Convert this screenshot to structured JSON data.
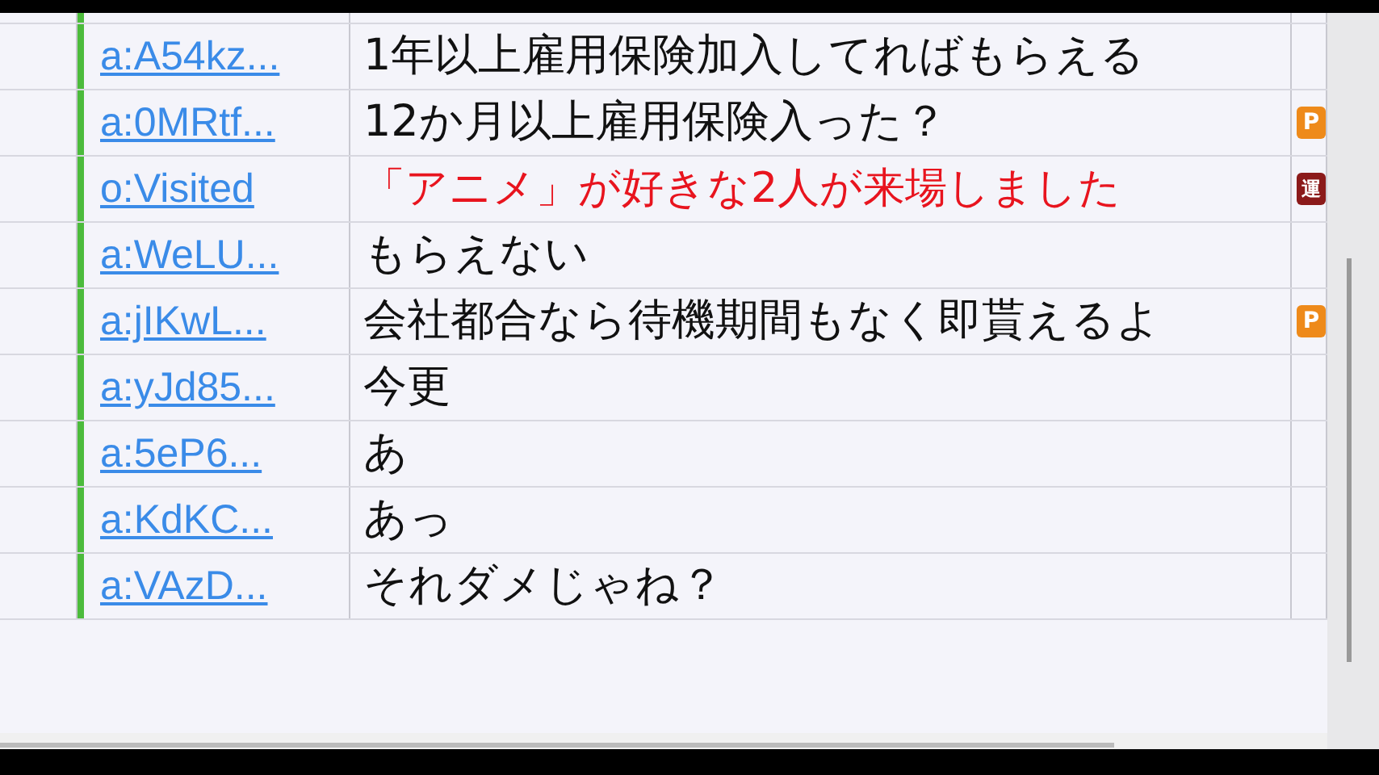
{
  "rows": [
    {
      "user": "a:A54kz...",
      "comment": "1年以上雇用保険加入してればもらえる",
      "kind": "normal"
    },
    {
      "user": "a:0MRtf...",
      "comment": "12か月以上雇用保険入った？",
      "kind": "normal",
      "badge": {
        "label": "P",
        "kind": "premium"
      }
    },
    {
      "user": "o:Visited",
      "comment": "「アニメ」が好きな2人が来場しました",
      "kind": "system",
      "badge": {
        "label": "運",
        "kind": "operator"
      }
    },
    {
      "user": "a:WeLU...",
      "comment": "もらえない",
      "kind": "normal"
    },
    {
      "user": "a:jIKwL...",
      "comment": "会社都合なら待機期間もなく即貰えるよ",
      "kind": "normal",
      "badge": {
        "label": "P",
        "kind": "premium"
      }
    },
    {
      "user": "a:yJd85...",
      "comment": "今更",
      "kind": "normal"
    },
    {
      "user": "a:5eP6...",
      "comment": "あ",
      "kind": "normal"
    },
    {
      "user": "a:KdKC...",
      "comment": "あっ",
      "kind": "normal"
    },
    {
      "user": "a:VAzD...",
      "comment": "それダメじゃね？",
      "kind": "normal"
    }
  ]
}
